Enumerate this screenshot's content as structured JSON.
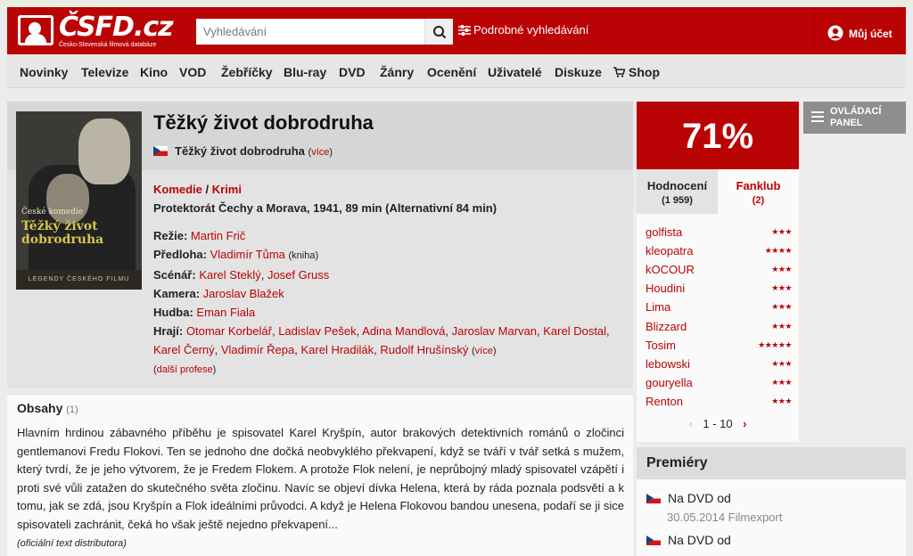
{
  "header": {
    "logo_text": "ČSFD.cz",
    "logo_sub": "Česko-Slovenská filmová databáze",
    "search_placeholder": "Vyhledávání",
    "advanced_search": "Podrobné vyhledávání",
    "account": "Můj účet"
  },
  "nav": [
    "Novinky",
    "Televize",
    "Kino",
    "VOD",
    "Žebříčky",
    "Blu-ray",
    "DVD",
    "Žánry",
    "Ocenění",
    "Uživatelé",
    "Diskuze",
    "Shop"
  ],
  "film": {
    "title": "Těžký život dobrodruha",
    "alt_title": "Těžký život dobrodruha",
    "more": "více",
    "genre1": "Komedie",
    "genre_sep": " / ",
    "genre2": "Krimi",
    "origin": "Protektorát Čechy a Morava, 1941, 89 min (Alternativní 84 min)",
    "poster_line1": "České komedie",
    "poster_line2": "Těžký život dobrodruha",
    "poster_footer": "LEGENDY ČESKÉHO FILMU",
    "directed_label": "Režie:",
    "directed": "Martin Frič",
    "source_label": "Předloha:",
    "source": "Vladimír Tůma",
    "source_note": "(kniha)",
    "writers_label": "Scénář:",
    "writer1": "Karel Steklý",
    "writer2": "Josef Gruss",
    "camera_label": "Kamera:",
    "camera": "Jaroslav Blažek",
    "music_label": "Hudba:",
    "music": "Eman Fiala",
    "cast_label": "Hrají:",
    "cast": [
      "Otomar Korbelář",
      "Ladislav Pešek",
      "Adina Mandlová",
      "Jaroslav Marvan",
      "Karel Dostal",
      "Karel Černý",
      "Vladimír Řepa",
      "Karel Hradilák",
      "Rudolf Hrušínský"
    ],
    "cast_more": "více",
    "other_professions": "další profese"
  },
  "content": {
    "heading": "Obsahy",
    "count": "(1)",
    "text": "Hlavním hrdinou zábavného příběhu je spisovatel Karel Kryšpín, autor brakových detektivních románů o zločinci gentlemanovi Fredu Flokovi. Ten se jednoho dne dočká neobvyklého překvapení, když se tváří v tvář setká s mužem, který tvrdí, že je jeho výtvorem, že je Fredem Flokem. A protože Flok nelení, je neprůbojný mladý spisovatel vzápětí i proti své vůli zatažen do skutečného světa zločinu. Navíc se objeví dívka Helena, která by ráda poznala podsvětí a k tomu, jak se zdá, jsou Kryšpín a Flok ideálními průvodci. A když je Helena Flokovou bandou unesena, podaří se ji sice spisovateli zachránit, čeká ho však ještě nejedno překvapení...",
    "source": "(oficiální text distributora)"
  },
  "rating": {
    "score": "71%",
    "tab_rating": "Hodnocení",
    "tab_rating_count": "(1 959)",
    "tab_fanclub": "Fanklub",
    "tab_fanclub_count": "(2)",
    "users": [
      {
        "name": "golfista",
        "stars": 3
      },
      {
        "name": "kleopatra",
        "stars": 4
      },
      {
        "name": "kOCOUR",
        "stars": 3
      },
      {
        "name": "Houdini",
        "stars": 3
      },
      {
        "name": "Lima",
        "stars": 3
      },
      {
        "name": "Blizzard",
        "stars": 3
      },
      {
        "name": "Tosim",
        "stars": 5
      },
      {
        "name": "lebowski",
        "stars": 3
      },
      {
        "name": "gouryella",
        "stars": 3
      },
      {
        "name": "Renton",
        "stars": 3
      }
    ],
    "pager": "1 - 10"
  },
  "panel_button": "OVLÁDACÍ PANEL",
  "premiery": {
    "heading": "Premiéry",
    "items": [
      {
        "label": "Na DVD od",
        "date": "30.05.2014 Filmexport"
      },
      {
        "label": "Na DVD od",
        "date": ""
      }
    ]
  },
  "colors": {
    "brand": "#ba0305",
    "nav_bg": "#e6e6e6"
  }
}
